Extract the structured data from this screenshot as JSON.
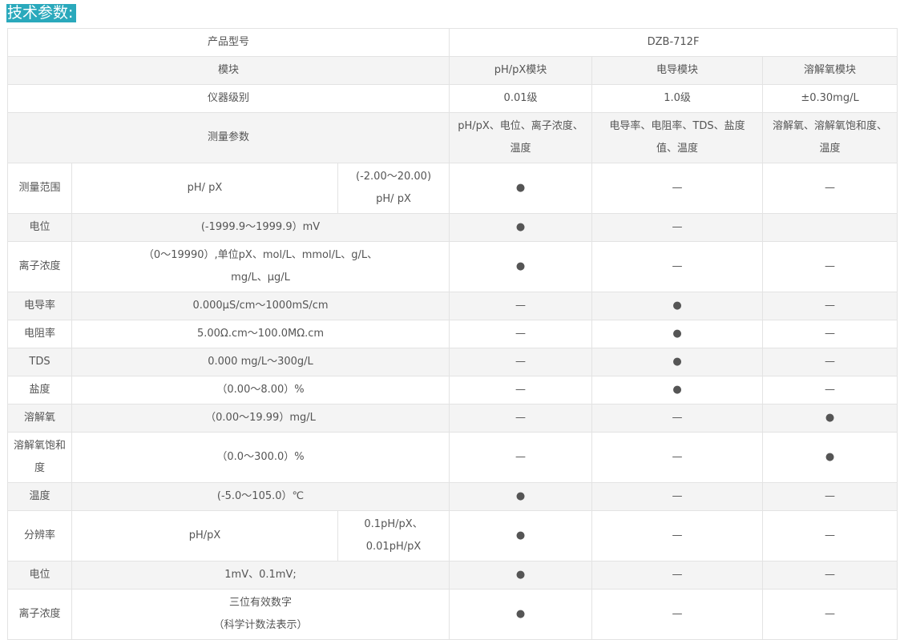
{
  "heading": "技术参数:",
  "colors": {
    "heading_bg": "#2aa9bc",
    "alt_row_bg": "#f4f4f4",
    "border": "#e3e3e3",
    "text": "#555555"
  },
  "header": {
    "model": {
      "label": "产品型号",
      "value": "DZB-712F"
    },
    "module": {
      "label": "模块",
      "cols": [
        "pH/pX模块",
        "电导模块",
        "溶解氧模块"
      ]
    },
    "grade": {
      "label": "仪器级别",
      "cols": [
        "0.01级",
        "1.0级",
        "±0.30mg/L"
      ]
    },
    "params": {
      "label": "测量参数",
      "cols": [
        "pH/pX、电位、离子浓度、\n温度",
        "电导率、电阻率、TDS、盐度\n值、温度",
        "溶解氧、溶解氧饱和度、\n温度"
      ]
    }
  },
  "rows": [
    {
      "label": "测量范围",
      "cells": [
        "pH/ pX",
        "(-2.00～20.00)\npH/ pX",
        "●",
        "—",
        "—"
      ]
    },
    {
      "label": "电位",
      "cells": [
        "(-1999.9～1999.9）mV",
        "●",
        "—",
        "",
        ""
      ]
    },
    {
      "label": "离子浓度",
      "cells": [
        "（0～19990）,单位pX、mol/L、mmol/L、g/L、\nmg/L、μg/L",
        "●",
        "—",
        "—",
        ""
      ]
    },
    {
      "label": "电导率",
      "cells": [
        "0.000μS/cm～1000mS/cm",
        "—",
        "●",
        "—",
        ""
      ]
    },
    {
      "label": "电阻率",
      "cells": [
        "5.00Ω.cm～100.0MΩ.cm",
        "—",
        "●",
        "—",
        ""
      ]
    },
    {
      "label": "TDS",
      "cells": [
        "0.000 mg/L～300g/L",
        "—",
        "●",
        "—",
        ""
      ]
    },
    {
      "label": "盐度",
      "cells": [
        "（0.00～8.00）%",
        "—",
        "●",
        "—",
        ""
      ]
    },
    {
      "label": "溶解氧",
      "cells": [
        "（0.00～19.99）mg/L",
        "—",
        "—",
        "●",
        ""
      ]
    },
    {
      "label": "溶解氧饱和\n度",
      "cells": [
        "（0.0～300.0）%",
        "—",
        "—",
        "●",
        ""
      ]
    },
    {
      "label": "温度",
      "cells": [
        "(-5.0～105.0）℃",
        "●",
        "—",
        "—",
        ""
      ]
    },
    {
      "label": "分辨率",
      "cells": [
        "pH/pX",
        "0.1pH/pX、\n0.01pH/pX",
        "●",
        "—",
        "—"
      ]
    },
    {
      "label": "电位",
      "cells": [
        "1mV、0.1mV;",
        "●",
        "—",
        "—",
        ""
      ]
    },
    {
      "label": "离子浓度",
      "cells": [
        "三位有效数字\n（科学计数法表示）",
        "●",
        "—",
        "—",
        ""
      ]
    }
  ]
}
